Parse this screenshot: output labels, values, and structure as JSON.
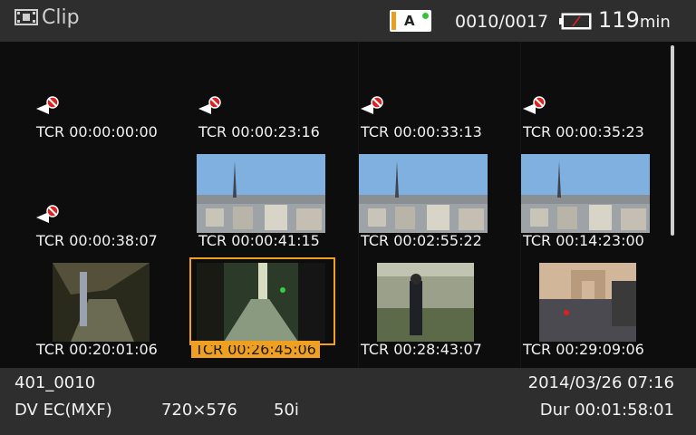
{
  "header": {
    "title": "Clip",
    "title_icon": "film-strip-icon",
    "media_slot": "A",
    "clip_counter": "0010/0017",
    "battery_icon": "battery-icon",
    "remaining": "119",
    "remaining_unit": "min"
  },
  "clips": [
    {
      "tcr": "TCR 00:00:00:00",
      "thumb": "clip-mark-icon"
    },
    {
      "tcr": "TCR 00:00:23:16",
      "thumb": "clip-mark-icon"
    },
    {
      "tcr": "TCR 00:00:33:13",
      "thumb": "clip-mark-icon"
    },
    {
      "tcr": "TCR 00:00:35:23",
      "thumb": "clip-mark-icon"
    },
    {
      "tcr": "TCR 00:00:38:07",
      "thumb": "clip-mark-icon"
    },
    {
      "tcr": "TCR 00:00:41:15",
      "thumb": "paris-skyline"
    },
    {
      "tcr": "TCR 00:02:55:22",
      "thumb": "paris-skyline"
    },
    {
      "tcr": "TCR 00:14:23:00",
      "thumb": "paris-skyline"
    },
    {
      "tcr": "TCR 00:20:01:06",
      "thumb": "metro-station"
    },
    {
      "tcr": "TCR 00:26:45:06",
      "thumb": "street-scene",
      "selected": true
    },
    {
      "tcr": "TCR 00:28:43:07",
      "thumb": "person-walking"
    },
    {
      "tcr": "TCR 00:29:09:06",
      "thumb": "arc-de-triomphe"
    }
  ],
  "footer": {
    "clip_name": "401_0010",
    "format": "DV EC(MXF)",
    "resolution": "720×576",
    "frame_rate": "50i",
    "date": "2014/03/26 07:16",
    "duration": "Dur 00:01:58:01"
  },
  "colors": {
    "accent": "#f0a020",
    "bar_bg": "#2e2e2e",
    "grid_bg": "#0d0d0d"
  }
}
